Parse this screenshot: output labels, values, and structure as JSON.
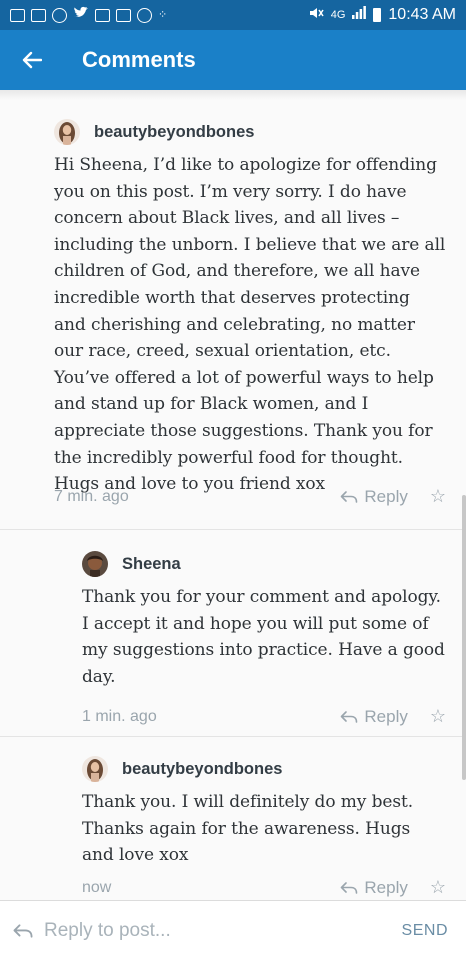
{
  "status_bar": {
    "time": "10:43 AM",
    "network": "4G",
    "notification_icons": [
      "facebook-icon",
      "cnn-icon",
      "wordpress-icon",
      "twitter-icon",
      "gallery-icon",
      "mail-icon",
      "news-icon",
      "dots-icon"
    ]
  },
  "header": {
    "title": "Comments"
  },
  "comments": [
    {
      "author": "beautybeyondbones",
      "body": "Hi Sheena, I’d like to apologize for offending you on this post. I’m very sorry. I do have concern about Black lives, and all lives – including the unborn. I believe that we are all children of God, and therefore, we all have incredible worth that deserves protecting and cherishing and celebrating, no matter our race, creed, sexual orientation, etc. You’ve offered a lot of powerful ways to help and stand up for Black women, and I appreciate those suggestions. Thank you for the incredibly powerful food for thought. Hugs and love to you friend xox",
      "time": "7 min. ago",
      "reply_label": "Reply"
    },
    {
      "author": "Sheena",
      "body": "Thank you for your comment and apology. I accept it and hope you will put some of my suggestions into practice. Have a good day.",
      "time": "1 min. ago",
      "reply_label": "Reply"
    },
    {
      "author": "beautybeyondbones",
      "body": "Thank you. I will definitely do my best. Thanks again for the awareness. Hugs and love xox",
      "time": "now",
      "reply_label": "Reply"
    }
  ],
  "reply_bar": {
    "placeholder": "Reply to post...",
    "send_label": "SEND"
  },
  "colors": {
    "status_bar": "#1565a0",
    "app_bar": "#1a80c8",
    "meta_text": "#9aa5ad"
  }
}
